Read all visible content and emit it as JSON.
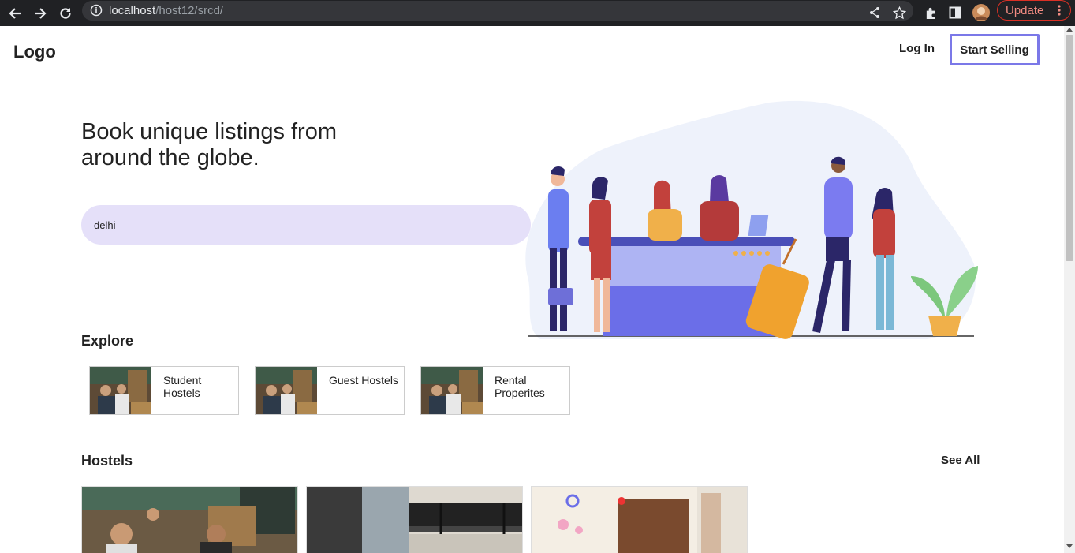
{
  "browser": {
    "url_host": "localhost",
    "url_path": "/host12/srcd/",
    "update_label": "Update"
  },
  "header": {
    "logo": "Logo",
    "login_label": "Log In",
    "start_selling_label": "Start Selling"
  },
  "hero": {
    "title": "Book unique listings from around the globe.",
    "search_value": "delhi"
  },
  "explore": {
    "title": "Explore",
    "items": [
      {
        "label": "Student Hostels"
      },
      {
        "label": "Guest Hostels"
      },
      {
        "label": "Rental Properites"
      }
    ]
  },
  "hostels": {
    "title": "Hostels",
    "see_all_label": "See All"
  },
  "colors": {
    "accent": "#7b78e8",
    "search_bg": "#e5e0f9",
    "update_red": "#d93025"
  }
}
